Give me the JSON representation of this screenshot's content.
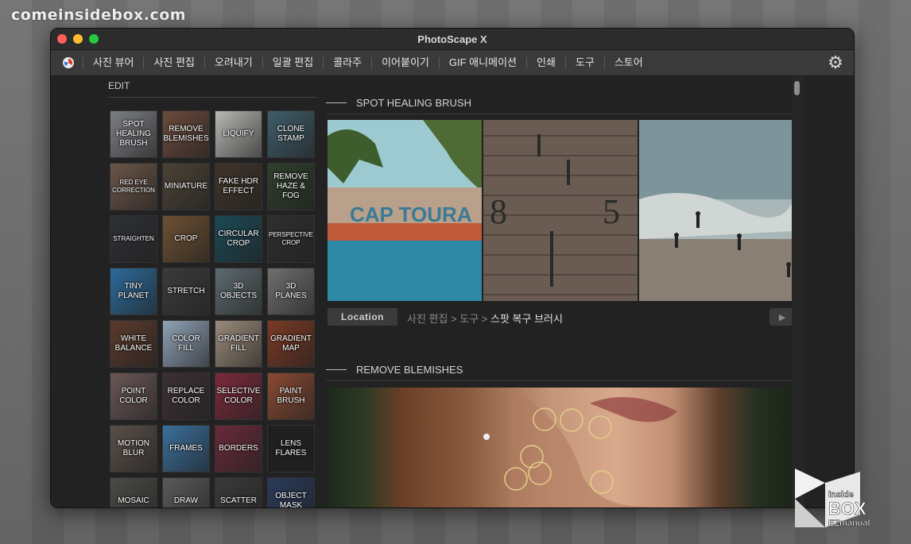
{
  "watermark": {
    "text": "comeinsidebox.com"
  },
  "window": {
    "title": "PhotoScape X"
  },
  "menu": {
    "logo_icon": "photoscape-logo-icon",
    "items": [
      "사진 뷰어",
      "사진 편집",
      "오려내기",
      "일괄 편집",
      "콜라주",
      "이어붙이기",
      "GIF 애니메이션",
      "인쇄",
      "도구",
      "스토어"
    ],
    "settings_icon": "gear-icon"
  },
  "sidebar": {
    "label": "EDIT",
    "tools": [
      {
        "label": "SPOT HEALING BRUSH",
        "bg": "#7d7f84"
      },
      {
        "label": "REMOVE BLEMISHES",
        "bg": "#6a4a3c"
      },
      {
        "label": "LIQUIFY",
        "bg": "#b7b7b4"
      },
      {
        "label": "CLONE STAMP",
        "bg": "#3f5d6a"
      },
      {
        "label": "RED EYE CORRECTION",
        "bg": "#6a5548",
        "small": true
      },
      {
        "label": "MINIATURE",
        "bg": "#4b4235"
      },
      {
        "label": "FAKE HDR EFFECT",
        "bg": "#3f3429"
      },
      {
        "label": "REMOVE HAZE & FOG",
        "bg": "#2e3f2c"
      },
      {
        "label": "STRAIGHTEN",
        "bg": "#2e3035",
        "small": true
      },
      {
        "label": "CROP",
        "bg": "#6d5032"
      },
      {
        "label": "CIRCULAR CROP",
        "bg": "#1c4a56"
      },
      {
        "label": "PERSPECTIVE CROP",
        "bg": "#2f2f2f",
        "small": true
      },
      {
        "label": "TINY PLANET",
        "bg": "#2d6a99"
      },
      {
        "label": "STRETCH",
        "bg": "#3b3b3b"
      },
      {
        "label": "3D OBJECTS",
        "bg": "#5d6a6f"
      },
      {
        "label": "3D PLANES",
        "bg": "#6f6f6f"
      },
      {
        "label": "WHITE BALANCE",
        "bg": "#5a3a2c"
      },
      {
        "label": "COLOR FILL",
        "bg": "#8fa2b5"
      },
      {
        "label": "GRADIENT FILL",
        "bg": "#9a8b7a"
      },
      {
        "label": "GRADIENT MAP",
        "bg": "#7a3a24"
      },
      {
        "label": "POINT COLOR",
        "bg": "#6a5656"
      },
      {
        "label": "REPLACE COLOR",
        "bg": "#3c3033"
      },
      {
        "label": "SELECTIVE COLOR",
        "bg": "#7a2a3a"
      },
      {
        "label": "PAINT BRUSH",
        "bg": "#8a4a33"
      },
      {
        "label": "MOTION BLUR",
        "bg": "#5a4f48"
      },
      {
        "label": "FRAMES",
        "bg": "#3a6f9a"
      },
      {
        "label": "BORDERS",
        "bg": "#6a2a3a"
      },
      {
        "label": "LENS FLARES",
        "bg": "#1f1f1f"
      },
      {
        "label": "MOSAIC",
        "bg": "#4a4a46"
      },
      {
        "label": "DRAW",
        "bg": "#5a5a5a"
      },
      {
        "label": "SCATTER",
        "bg": "#3a3a3a"
      },
      {
        "label": "OBJECT MASK",
        "bg": "#2a3a5a"
      }
    ]
  },
  "sections": [
    {
      "title": "SPOT HEALING BRUSH"
    },
    {
      "title": "REMOVE BLEMISHES"
    }
  ],
  "location": {
    "button": "Location",
    "path_prefix": "사진 편집 > 도구 > ",
    "path_current": "스팟 복구 브러시",
    "play_icon": "play-icon"
  },
  "corner_logo": {
    "line1": "inside",
    "line2": "BOX",
    "line3": "EZmanual"
  }
}
